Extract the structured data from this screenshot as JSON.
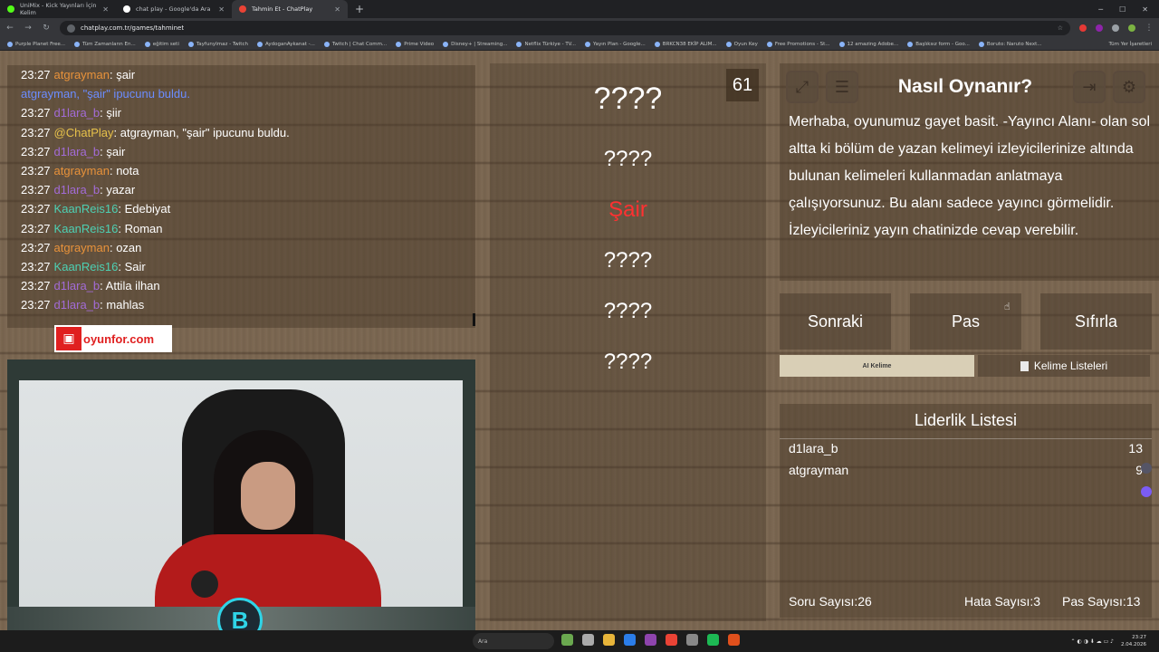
{
  "browser": {
    "tabs": [
      {
        "title": "UniMix - Kick Yayınları İçin Kelim",
        "active": false
      },
      {
        "title": "chat play - Google'da Ara",
        "active": false
      },
      {
        "title": "Tahmin Et - ChatPlay",
        "active": true
      }
    ],
    "url": "chatplay.com.tr/games/tahminet",
    "bookmarks": [
      "Purple Planet Free...",
      "Tüm Zamanların En...",
      "eğitim seti",
      "TayfunyImaz - Twitch",
      "AydoganAykanat -...",
      "Twitch | Chat Comm...",
      "Prime Video",
      "Disney+ | Streaming...",
      "Netflix Türkiye - TV...",
      "Yayın Plan - Google...",
      "BRKCN38 EKİP ALIM...",
      "Oyun Key",
      "Free Promotions - St...",
      "12 amazing Adobe...",
      "Başlıksız form - Goo...",
      "Boruto: Naruto Next..."
    ],
    "bookmarks_all": "Tüm Yer İşaretleri"
  },
  "chat": {
    "lines": [
      {
        "time": "23:27",
        "user": "atgrayman",
        "color": "#e8923a",
        "msg": ": şair"
      },
      {
        "time": "",
        "user": "",
        "color": "#6b8cff",
        "msg": "atgrayman, \"şair\" ipucunu buldu.",
        "system": true
      },
      {
        "time": "23:27",
        "user": "d1lara_b",
        "color": "#a26bd6",
        "msg": ": şiir"
      },
      {
        "time": "23:27",
        "user": "@ChatPlay",
        "color": "#e6c14a",
        "msg": ": atgrayman, \"şair\" ipucunu buldu."
      },
      {
        "time": "23:27",
        "user": "d1lara_b",
        "color": "#a26bd6",
        "msg": ": şair"
      },
      {
        "time": "23:27",
        "user": "atgrayman",
        "color": "#e8923a",
        "msg": ": nota"
      },
      {
        "time": "23:27",
        "user": "d1lara_b",
        "color": "#a26bd6",
        "msg": ": yazar"
      },
      {
        "time": "23:27",
        "user": "KaanReis16",
        "color": "#4dd0b3",
        "msg": ": Edebiyat"
      },
      {
        "time": "23:27",
        "user": "KaanReis16",
        "color": "#4dd0b3",
        "msg": ": Roman"
      },
      {
        "time": "23:27",
        "user": "atgrayman",
        "color": "#e8923a",
        "msg": ": ozan"
      },
      {
        "time": "23:27",
        "user": "KaanReis16",
        "color": "#4dd0b3",
        "msg": ": Sair"
      },
      {
        "time": "23:27",
        "user": "d1lara_b",
        "color": "#a26bd6",
        "msg": ": Attila ilhan"
      },
      {
        "time": "23:27",
        "user": "d1lara_b",
        "color": "#a26bd6",
        "msg": ": mahlas"
      }
    ]
  },
  "sponsor": {
    "text": "oyunfor.com"
  },
  "game": {
    "timer": "61",
    "words": [
      "????",
      "????",
      "Şair",
      "????",
      "????",
      "????"
    ],
    "howto_title": "Nasıl Oynanır?",
    "howto_text": "Merhaba, oyunumuz gayet basit. -Yayıncı Alanı- olan sol altta ki bölüm de yazan kelimeyi izleyicilerinize altında bulunan kelimeleri kullanmadan anlatmaya çalışıyorsunuz. Bu alanı sadece yayıncı görmelidir. İzleyicileriniz yayın chatinizde cevap verebilir.",
    "buttons": {
      "next": "Sonraki",
      "pass": "Pas",
      "reset": "Sıfırla"
    },
    "ai_button": "AI Kelime",
    "word_lists_button": "Kelime Listeleri",
    "leaderboard_title": "Liderlik Listesi",
    "leaderboard": [
      {
        "name": "d1lara_b",
        "score": "13"
      },
      {
        "name": "atgrayman",
        "score": "9"
      }
    ],
    "stats": {
      "questions_label": "Soru Sayısı:",
      "questions": "26",
      "errors_label": "Hata Sayısı:",
      "errors": "3",
      "passes_label": "Pas Sayısı:",
      "passes": "13"
    }
  },
  "taskbar": {
    "search": "Ara",
    "time": "23:27",
    "date": "2.04.2026"
  }
}
